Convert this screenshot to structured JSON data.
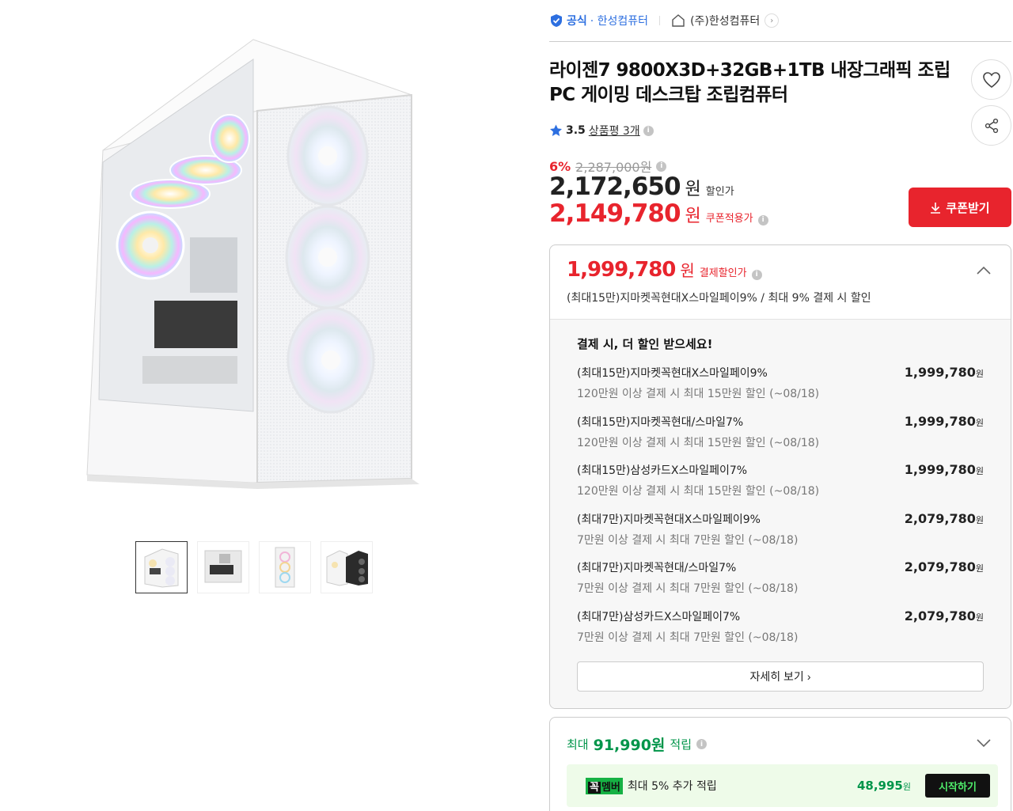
{
  "seller": {
    "official_label": "공식",
    "official_shop": "· 한성컴퓨터",
    "store_name": "(주)한성컴퓨터"
  },
  "product": {
    "title": "라이젠7 9800X3D+32GB+1TB 내장그래픽 조립PC 게이밍 데스크탑 조립컴퓨터",
    "rating": "3.5",
    "reviews": "상품평 3개"
  },
  "pricing": {
    "discount_pct": "6%",
    "original_price": "2,287,000원",
    "sale_price": "2,172,650",
    "sale_unit": "원",
    "sale_label": "할인가",
    "coupon_price": "2,149,780",
    "coupon_unit": "원",
    "coupon_label": "쿠폰적용가",
    "coupon_button": "쿠폰받기"
  },
  "payment": {
    "price": "1,999,780",
    "unit": "원",
    "label": "결제할인가",
    "description": "(최대15만)지마켓꼭현대X스마일페이9% / 최대 9% 결제 시 할인",
    "heading": "결제 시, 더 할인 받으세요!",
    "offers": [
      {
        "name": "(최대15만)지마켓꼭현대X스마일페이9%",
        "condition": "120만원 이상 결제 시 최대 15만원 할인 (~08/18)",
        "amount": "1,999,780",
        "unit": "원"
      },
      {
        "name": "(최대15만)지마켓꼭현대/스마일7%",
        "condition": "120만원 이상 결제 시 최대 15만원 할인 (~08/18)",
        "amount": "1,999,780",
        "unit": "원"
      },
      {
        "name": "(최대15만)삼성카드X스마일페이7%",
        "condition": "120만원 이상 결제 시 최대 15만원 할인 (~08/18)",
        "amount": "1,999,780",
        "unit": "원"
      },
      {
        "name": "(최대7만)지마켓꼭현대X스마일페이9%",
        "condition": "7만원 이상 결제 시 최대 7만원 할인 (~08/18)",
        "amount": "2,079,780",
        "unit": "원"
      },
      {
        "name": "(최대7만)지마켓꼭현대/스마일7%",
        "condition": "7만원 이상 결제 시 최대 7만원 할인 (~08/18)",
        "amount": "2,079,780",
        "unit": "원"
      },
      {
        "name": "(최대7만)삼성카드X스마일페이7%",
        "condition": "7만원 이상 결제 시 최대 7만원 할인 (~08/18)",
        "amount": "2,079,780",
        "unit": "원"
      }
    ],
    "detail_button": "자세히 보기"
  },
  "reward": {
    "prefix": "최대",
    "amount": "91,990원",
    "suffix": "적립",
    "member_badge_a": "꼭",
    "member_badge_b": "멤버",
    "member_text": "최대 5% 추가 적립",
    "member_amount": "48,995",
    "member_unit": "원",
    "start_button": "시작하기"
  },
  "icons": [
    "shield-check-icon",
    "home-icon",
    "chevron-right-icon",
    "heart-icon",
    "share-icon",
    "star-icon",
    "info-icon",
    "download-icon",
    "chevron-up-icon",
    "chevron-down-icon"
  ],
  "colors": {
    "accent_red": "#e8242d",
    "official_blue": "#2d6fe0",
    "reward_green": "#00954a",
    "member_bg": "#eefbe9"
  }
}
